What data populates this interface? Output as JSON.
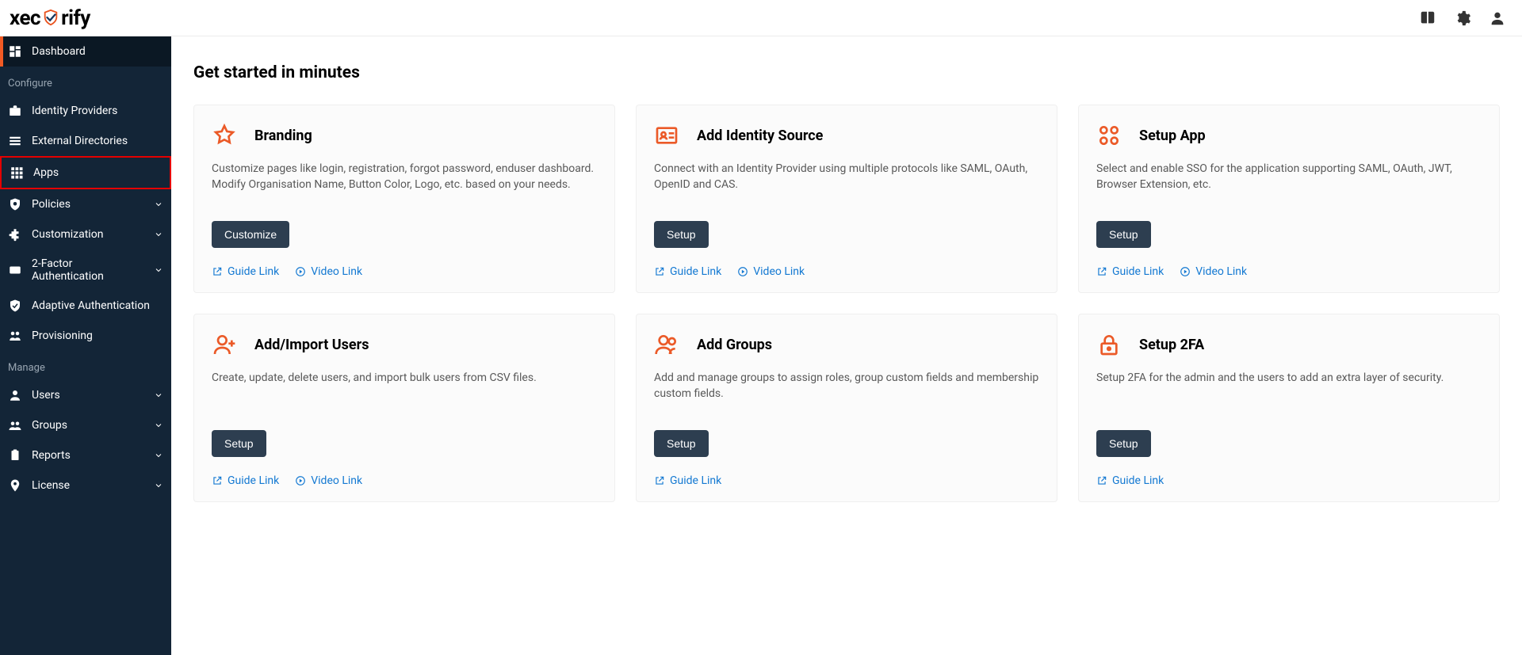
{
  "logo": {
    "part1": "xec",
    "part2": "rify"
  },
  "sidebar": {
    "groups": [
      {
        "title": null,
        "items": [
          {
            "label": "Dashboard",
            "icon": "dashboard",
            "active": true
          }
        ]
      },
      {
        "title": "Configure",
        "items": [
          {
            "label": "Identity Providers",
            "icon": "briefcase"
          },
          {
            "label": "External Directories",
            "icon": "list"
          },
          {
            "label": "Apps",
            "icon": "grid",
            "highlighted": true
          },
          {
            "label": "Policies",
            "icon": "shield-badge",
            "expandable": true
          },
          {
            "label": "Customization",
            "icon": "puzzle",
            "expandable": true
          },
          {
            "label": "2-Factor Authentication",
            "icon": "twofa",
            "expandable": true
          },
          {
            "label": "Adaptive Authentication",
            "icon": "shield"
          },
          {
            "label": "Provisioning",
            "icon": "people-sync"
          }
        ]
      },
      {
        "title": "Manage",
        "items": [
          {
            "label": "Users",
            "icon": "user",
            "expandable": true
          },
          {
            "label": "Groups",
            "icon": "group",
            "expandable": true
          },
          {
            "label": "Reports",
            "icon": "clipboard",
            "expandable": true
          },
          {
            "label": "License",
            "icon": "location",
            "expandable": true
          }
        ]
      }
    ]
  },
  "main": {
    "title": "Get started in minutes",
    "cards": [
      {
        "icon": "star",
        "title": "Branding",
        "desc": "Customize pages like login, registration, forgot password, enduser dashboard. Modify Organisation Name, Button Color, Logo, etc. based on your needs.",
        "button": "Customize",
        "guide": "Guide Link",
        "video": "Video Link"
      },
      {
        "icon": "idcard",
        "title": "Add Identity Source",
        "desc": "Connect with an Identity Provider using multiple protocols like SAML, OAuth, OpenID and CAS.",
        "button": "Setup",
        "guide": "Guide Link",
        "video": "Video Link"
      },
      {
        "icon": "apps",
        "title": "Setup App",
        "desc": "Select and enable SSO for the application supporting SAML, OAuth, JWT, Browser Extension, etc.",
        "button": "Setup",
        "guide": "Guide Link",
        "video": "Video Link"
      },
      {
        "icon": "user-plus",
        "title": "Add/Import Users",
        "desc": "Create, update, delete users, and import bulk users from CSV files.",
        "button": "Setup",
        "guide": "Guide Link",
        "video": "Video Link"
      },
      {
        "icon": "users",
        "title": "Add Groups",
        "desc": "Add and manage groups to assign roles, group custom fields and membership custom fields.",
        "button": "Setup",
        "guide": "Guide Link"
      },
      {
        "icon": "lock",
        "title": "Setup 2FA",
        "desc": "Setup 2FA for the admin and the users to add an extra layer of security.",
        "button": "Setup",
        "guide": "Guide Link"
      }
    ]
  }
}
